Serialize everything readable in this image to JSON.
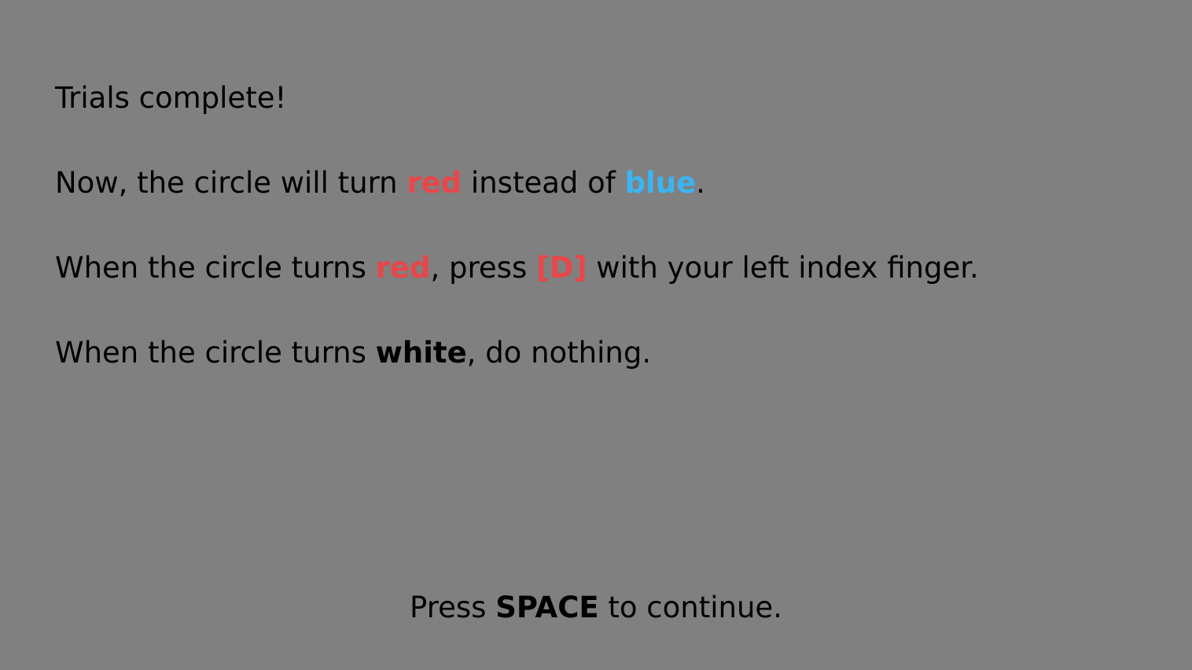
{
  "colors": {
    "background": "#808080",
    "text": "#000000",
    "red": "#E8474A",
    "blue": "#3BB4F0"
  },
  "line1": {
    "text": "Trials complete!"
  },
  "line2": {
    "before": "Now, the circle will turn ",
    "red_word": "red",
    "middle": " instead of ",
    "blue_word": "blue",
    "after": "."
  },
  "line3": {
    "before": "When the circle turns ",
    "red_word": "red",
    "middle": ", press ",
    "key": "[D]",
    "after": " with your left index finger."
  },
  "line4": {
    "before": "When the circle turns ",
    "white_word": "white",
    "after": ", do nothing."
  },
  "footer": {
    "before": "Press ",
    "key": "SPACE",
    "after": " to continue."
  }
}
